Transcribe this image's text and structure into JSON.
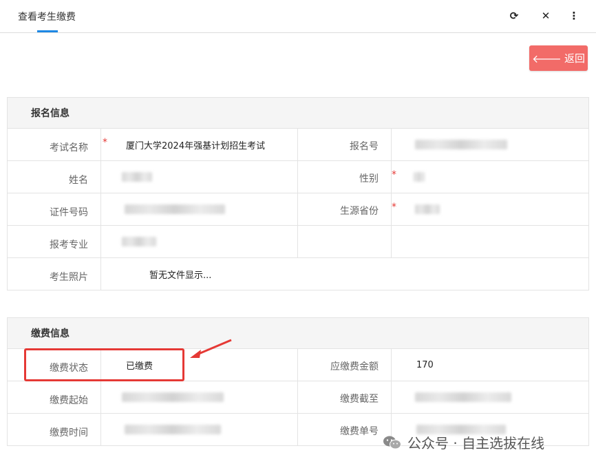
{
  "tab": {
    "title": "查看考生缴费"
  },
  "toolbar": {
    "refresh_icon": "refresh-icon",
    "close_icon": "close-icon",
    "more_icon": "more-vertical-icon"
  },
  "back_button": {
    "label": "返回",
    "icon": "arrow-left-icon",
    "color": "#f26b68"
  },
  "registration": {
    "title": "报名信息",
    "exam_name_label": "考试名称",
    "exam_name_value": "厦门大学2024年强基计划招生考试",
    "reg_no_label": "报名号",
    "name_label": "姓名",
    "gender_label": "性别",
    "id_label": "证件号码",
    "province_label": "生源省份",
    "major_label": "报考专业",
    "photo_label": "考生照片",
    "photo_value": "暂无文件显示...",
    "required_mark": "*"
  },
  "payment": {
    "title": "缴费信息",
    "status_label": "缴费状态",
    "status_value": "已缴费",
    "amount_label": "应缴费金额",
    "amount_value": "170",
    "start_label": "缴费起始",
    "end_label": "缴费截至",
    "time_label": "缴费时间",
    "order_label": "缴费单号"
  },
  "watermark": {
    "text": "公众号 · 自主选拔在线"
  },
  "colors": {
    "accent": "#1e88e5",
    "annotation": "#e53935"
  }
}
